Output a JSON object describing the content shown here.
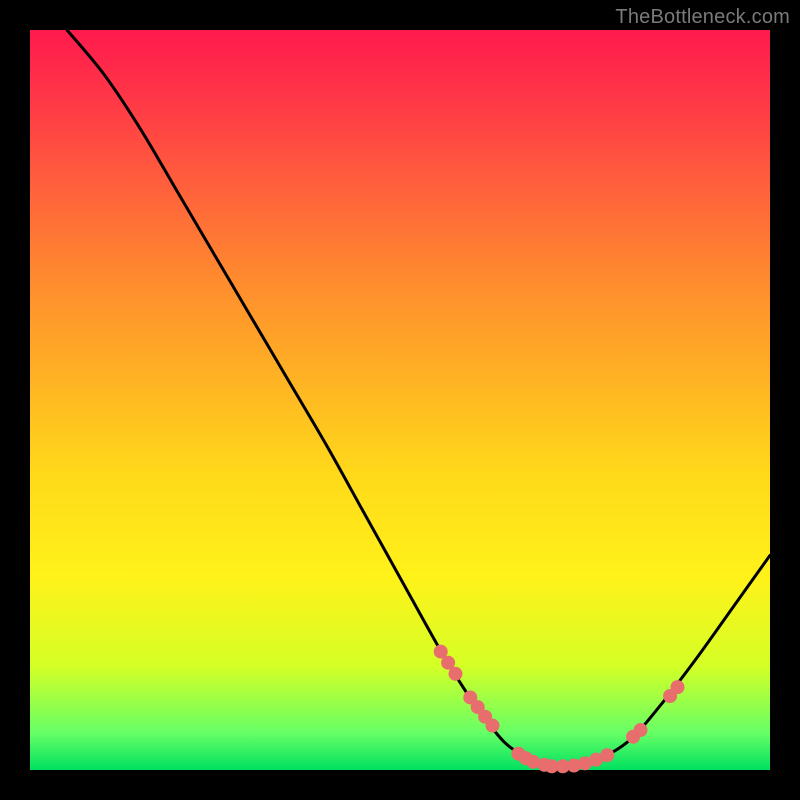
{
  "watermark": "TheBottleneck.com",
  "chart_data": {
    "type": "line",
    "title": "",
    "xlabel": "",
    "ylabel": "",
    "xlim": [
      0,
      100
    ],
    "ylim": [
      0,
      100
    ],
    "curve": {
      "name": "bottleneck-curve",
      "x": [
        5,
        10,
        15,
        20,
        25,
        30,
        35,
        40,
        45,
        50,
        55,
        58,
        60,
        63,
        65,
        68,
        71,
        74,
        77,
        81,
        85,
        90,
        95,
        100
      ],
      "y": [
        100,
        94,
        86.5,
        78,
        69.5,
        61,
        52.5,
        44,
        35,
        26,
        17,
        12,
        9,
        5,
        3,
        1.2,
        0.5,
        0.5,
        1.5,
        4,
        8.5,
        15,
        22,
        29
      ]
    },
    "highlight_points": {
      "name": "marker-dots",
      "color": "#e86d6d",
      "x": [
        55.5,
        56.5,
        57.5,
        59.5,
        60.5,
        61.5,
        62.5,
        66.0,
        67.0,
        68.0,
        69.5,
        70.5,
        72.0,
        73.5,
        75.0,
        76.5,
        78.0,
        81.5,
        82.5,
        86.5,
        87.5
      ],
      "y": [
        16.0,
        14.5,
        13.0,
        9.8,
        8.5,
        7.2,
        6.0,
        2.2,
        1.6,
        1.1,
        0.7,
        0.5,
        0.5,
        0.6,
        0.9,
        1.4,
        2.0,
        4.5,
        5.4,
        10.0,
        11.2
      ]
    }
  }
}
